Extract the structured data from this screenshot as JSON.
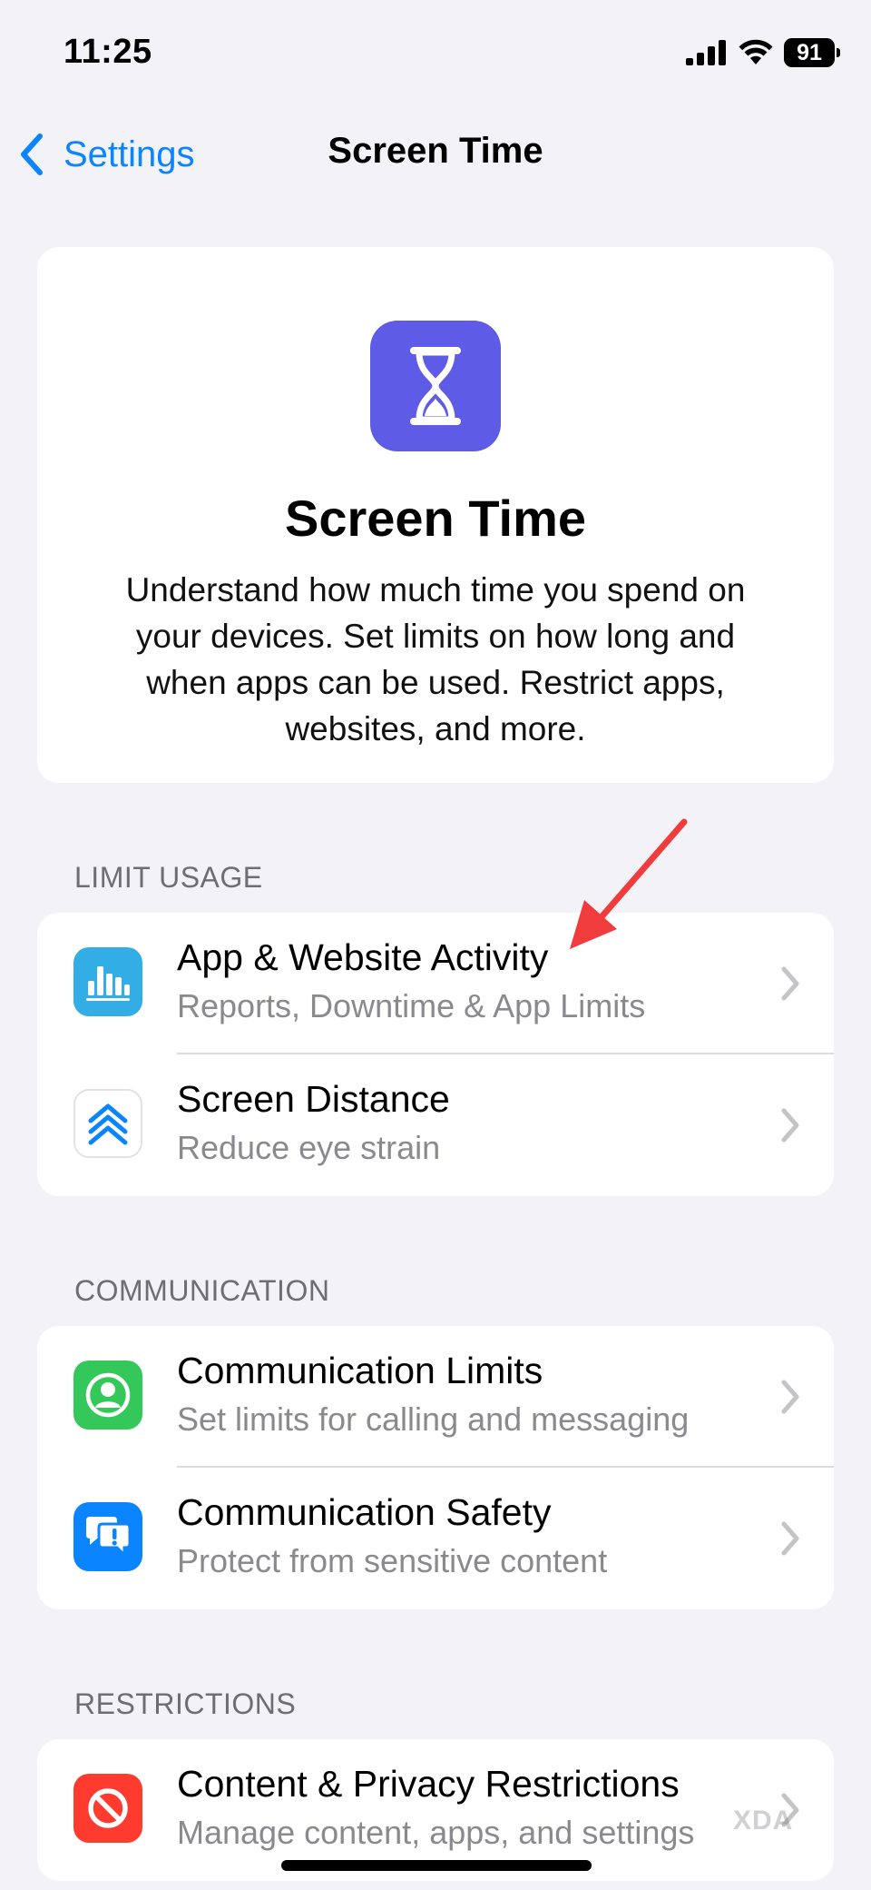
{
  "status_bar": {
    "time": "11:25",
    "battery": "91"
  },
  "nav": {
    "back_label": "Settings",
    "title": "Screen Time"
  },
  "hero": {
    "title": "Screen Time",
    "description": "Understand how much time you spend on your devices. Set limits on how long and when apps can be used. Restrict apps, websites, and more."
  },
  "sections": [
    {
      "header": "LIMIT USAGE",
      "items": [
        {
          "title": "App & Website Activity",
          "subtitle": "Reports, Downtime & App Limits",
          "icon": "bar-chart-icon",
          "color": "#32ade6"
        },
        {
          "title": "Screen Distance",
          "subtitle": "Reduce eye strain",
          "icon": "double-chevron-up-icon",
          "color": "#ffffff"
        }
      ]
    },
    {
      "header": "COMMUNICATION",
      "items": [
        {
          "title": "Communication Limits",
          "subtitle": "Set limits for calling and messaging",
          "icon": "person-circle-icon",
          "color": "#34c759"
        },
        {
          "title": "Communication Safety",
          "subtitle": "Protect from sensitive content",
          "icon": "chat-bubble-alert-icon",
          "color": "#0a84ff"
        }
      ]
    },
    {
      "header": "RESTRICTIONS",
      "items": [
        {
          "title": "Content & Privacy Restrictions",
          "subtitle": "Manage content, apps, and settings",
          "icon": "no-entry-icon",
          "color": "#ff3b30"
        }
      ]
    }
  ],
  "watermark": "XDA",
  "colors": {
    "accent": "#0a84ff",
    "screen_time_icon": "#5e5ce6",
    "annotation_arrow": "#f03c3c",
    "background": "#f2f2f7"
  }
}
